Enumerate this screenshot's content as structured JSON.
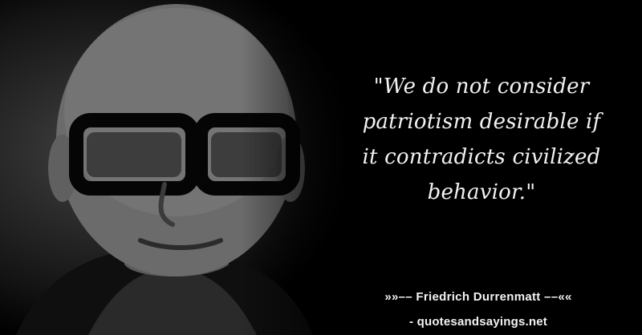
{
  "quote": {
    "text": "\"We do not consider\npatriotism desirable if\nit contradicts civilized\nbehavior.\""
  },
  "author": {
    "line": "»»–– Friedrich Durrenmatt ––««"
  },
  "source": {
    "line": "- quotesandsayings.net"
  },
  "palette": {
    "background": "#000000",
    "text": "#f2f2f2"
  }
}
